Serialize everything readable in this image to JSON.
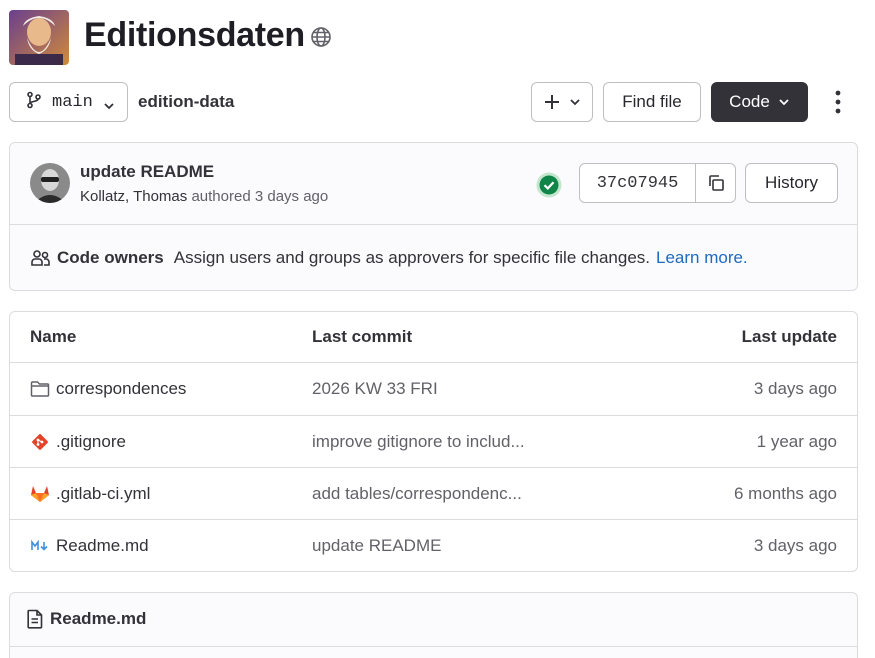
{
  "project": {
    "title": "Editionsdaten",
    "visibility_icon": "globe-icon"
  },
  "toolbar": {
    "branch_label": "main",
    "breadcrumb": "edition-data",
    "plus_label": "+",
    "find_file_label": "Find file",
    "code_label": "Code"
  },
  "commit": {
    "title": "update README",
    "author": "Kollatz, Thomas",
    "meta_suffix": "authored 3 days ago",
    "sha": "37c07945",
    "history_label": "History",
    "pipeline_status": "passed"
  },
  "codeowners": {
    "label": "Code owners",
    "text": "Assign users and groups as approvers for specific file changes.",
    "link": "Learn more."
  },
  "files": {
    "headers": {
      "name": "Name",
      "last_commit": "Last commit",
      "last_update": "Last update"
    },
    "rows": [
      {
        "name": "correspondences",
        "icon": "folder-icon",
        "commit": "2026 KW 33 FRI",
        "updated": "3 days ago"
      },
      {
        "name": ".gitignore",
        "icon": "git-icon",
        "commit": "improve gitignore to includ...",
        "updated": "1 year ago"
      },
      {
        "name": ".gitlab-ci.yml",
        "icon": "gitlab-icon",
        "commit": "add tables/correspondenc...",
        "updated": "6 months ago"
      },
      {
        "name": "Readme.md",
        "icon": "markdown-icon",
        "commit": "update README",
        "updated": "3 days ago"
      }
    ]
  },
  "readme": {
    "title": "Readme.md"
  },
  "colors": {
    "primary_dark": "#333238",
    "link": "#1f6abf",
    "success": "#108548",
    "border": "#dcdcde",
    "gitlab_orange": "#e24329"
  }
}
